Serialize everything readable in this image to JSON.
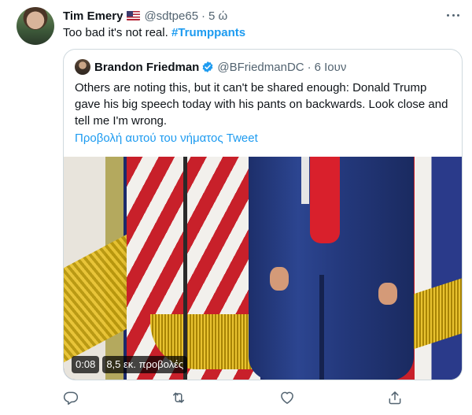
{
  "tweet": {
    "author_name": "Tim Emery",
    "author_handle": "@sdtpe65",
    "separator": "·",
    "time": "5 ώ",
    "text": "Too bad it's not real. ",
    "hashtag": "#Trumppants"
  },
  "quoted_tweet": {
    "author_name": "Brandon Friedman",
    "author_handle": "@BFriedmanDC",
    "separator": "·",
    "time": "6 Ιουν",
    "text": "Others are noting this, but it can't be shared enough: Donald Trump gave his big speech today with his pants on backwards. Look close and tell me I'm wrong.",
    "thread_link": "Προβολή αυτού του νήματος Tweet",
    "video": {
      "duration": "0:08",
      "views": "8,5 εκ. προβολές"
    }
  },
  "icons": {
    "more": "more-icon",
    "reply": "reply-icon",
    "retweet": "retweet-icon",
    "like": "like-icon",
    "share": "share-icon",
    "verified": "verified-badge-icon"
  },
  "colors": {
    "link": "#1d9bf0",
    "secondary_text": "#536471",
    "border": "#cfd9de"
  }
}
